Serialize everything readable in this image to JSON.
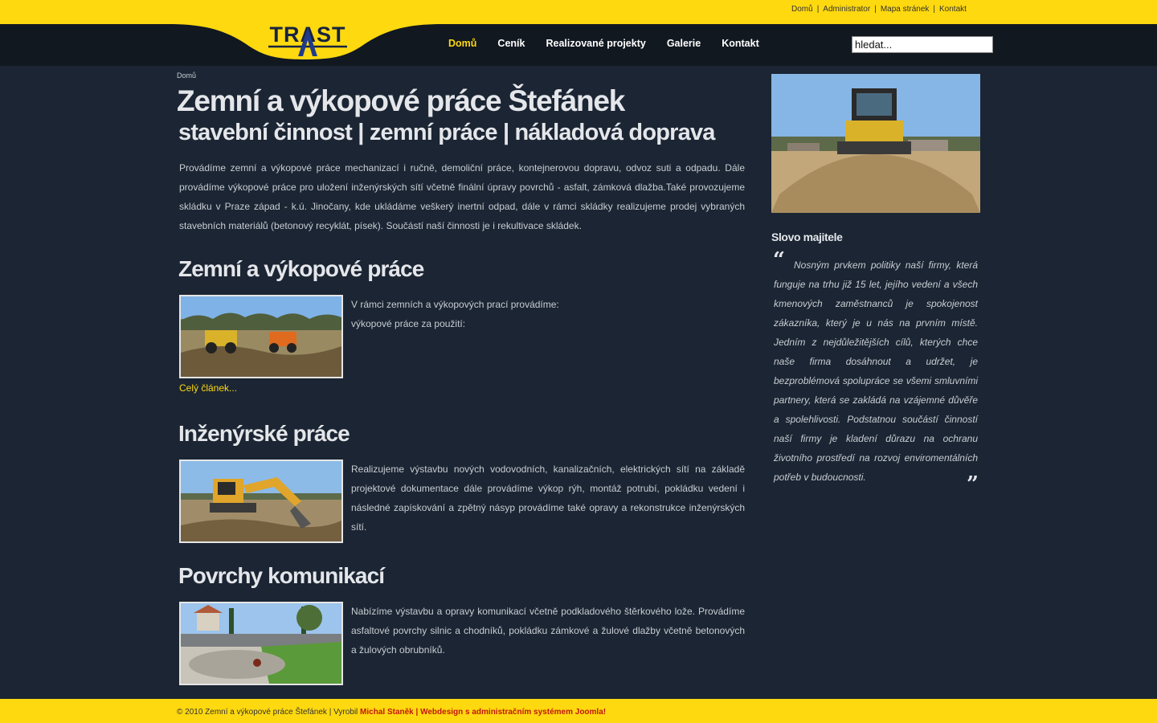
{
  "colors": {
    "accent": "#ffd90f",
    "background": "#1b2533",
    "navbar": "#111820",
    "footer_link": "#c0180f"
  },
  "header": {
    "logo_text": "TRAST",
    "top_links": [
      "Domů",
      "Administrator",
      "Mapa stránek",
      "Kontakt"
    ],
    "nav": [
      {
        "label": "Domů",
        "active": true
      },
      {
        "label": "Ceník",
        "active": false
      },
      {
        "label": "Realizované projekty",
        "active": false
      },
      {
        "label": "Galerie",
        "active": false
      },
      {
        "label": "Kontakt",
        "active": false
      }
    ],
    "search_value": "hledat..."
  },
  "main": {
    "breadcrumb": "Domů",
    "title": "Zemní a výkopové práce Štefánek",
    "subtitle": "stavební činnost | zemní práce | nákladová doprava",
    "intro": "Provádíme zemní a výkopové práce mechanizací i ručně, demoliční práce, kontejnerovou dopravu, odvoz suti a odpadu. Dále provádíme výkopové práce pro uložení inženýrských sítí včetně finální úpravy povrchů - asfalt, zámková dlažba.Také provozujeme skládku v Praze západ - k.ú. Jinočany, kde ukládáme veškerý inertní odpad, dále v rámci skládky realizujeme prodej vybraných stavebních materiálů (betonový recyklát, písek). Součástí naší činnosti je i rekultivace skládek.",
    "sections": [
      {
        "title": "Zemní a výkopové práce",
        "text_line1": "V rámci zemních a výkopových prací provádíme:",
        "text_line2": "výkopové práce za použití:",
        "more": "Celý článek..."
      },
      {
        "title": "Inženýrské práce",
        "text": "Realizujeme výstavbu nových vodovodních, kanalizačních, elektrických sítí na základě projektové dokumentace dále provádíme výkop rýh, montáž potrubí, pokládku vedení i následné zapískování a zpětný násyp provádíme také opravy a rekonstrukce inženýrských sítí."
      },
      {
        "title": "Povrchy komunikací",
        "text": "Nabízíme výstavbu a opravy komunikací včetně podkladového štěrkového lože. Provádíme asfaltové povrchy silnic a chodníků, pokládku zámkové a žulové dlažby včetně betonových a žulových obrubníků."
      }
    ]
  },
  "sidebar": {
    "heading": "Slovo majitele",
    "quote_open": "“",
    "quote_close": "”",
    "quote": "Nosným prvkem politiky naší firmy, která funguje na trhu již 15 let, jejího vedení a všech kmenových zaměstnanců je spokojenost zákazníka, který je u nás na prvním místě. Jedním z nejdůležitějších cílů, kterých chce naše firma dosáhnout a udržet, je bezproblémová spolupráce se všemi smluvními partnery, která se zakládá na vzájemné důvěře a spolehlivosti. Podstatnou součástí činností naší firmy je kladení důrazu na ochranu životního prostředí na rozvoj enviromentálních potřeb v budoucnosti."
  },
  "footer": {
    "prefix": "© 2010 Zemní a výkopové práce Štefánek | Vyrobil ",
    "link": "Michal Staněk | Webdesign s administračním systémem Joomla!"
  }
}
